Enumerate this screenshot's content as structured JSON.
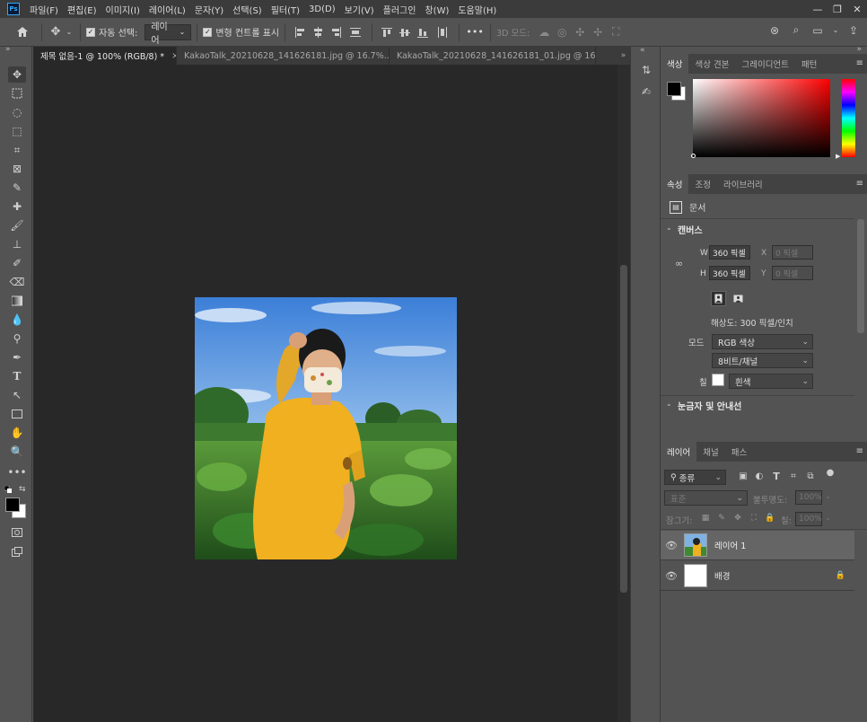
{
  "app": {
    "logo": "Ps"
  },
  "menu": [
    "파일(F)",
    "편집(E)",
    "이미지(I)",
    "레이어(L)",
    "문자(Y)",
    "선택(S)",
    "필터(T)",
    "3D(D)",
    "보기(V)",
    "플러그인",
    "창(W)",
    "도움말(H)"
  ],
  "window_controls": {
    "minimize": "—",
    "restore": "❐",
    "close": "✕"
  },
  "options": {
    "auto_select_label": "자동 선택:",
    "auto_select_value": "레이어",
    "transform_label": "변형 컨트롤 표시",
    "more": "•••",
    "mode_3d": "3D 모드:"
  },
  "tabs": [
    {
      "label": "제목 없음-1 @ 100% (RGB/8) *",
      "close": "×"
    },
    {
      "label": "KakaoTalk_20210628_141626181.jpg @ 16.7%...",
      "close": "×"
    },
    {
      "label": "KakaoTalk_20210628_141626181_01.jpg @ 16...",
      "close": "×"
    }
  ],
  "color_panel": {
    "tabs": [
      "색상",
      "색상 견본",
      "그레이디언트",
      "패턴"
    ],
    "foreground": "#000000",
    "background": "#ffffff",
    "hue_color": "#ff0000"
  },
  "properties_panel": {
    "tabs": [
      "속성",
      "조정",
      "라이브러리"
    ],
    "doc_label": "문서",
    "canvas_title": "캔버스",
    "w_label": "W",
    "w_value": "360 픽셀",
    "h_label": "H",
    "h_value": "360 픽셀",
    "x_label": "X",
    "x_value": "0 픽셀",
    "y_label": "Y",
    "y_value": "0 픽셀",
    "resolution": "해상도: 300 픽셀/인치",
    "mode_label": "모드",
    "mode_value": "RGB 색상",
    "bit_value": "8비트/채널",
    "fill_label": "칠",
    "fill_value": "흰색",
    "rulers_title": "눈금자 및 안내선"
  },
  "layers_panel": {
    "tabs": [
      "레이어",
      "채널",
      "패스"
    ],
    "filter_kind": "종류",
    "blend_mode": "표준",
    "opacity_label": "불투명도:",
    "opacity_value": "100%",
    "lock_label": "잠그기:",
    "fill_label": "칠:",
    "fill_value": "100%",
    "layers": [
      {
        "name": "레이어 1",
        "visible": true,
        "locked": false
      },
      {
        "name": "배경",
        "visible": true,
        "locked": true
      }
    ]
  }
}
